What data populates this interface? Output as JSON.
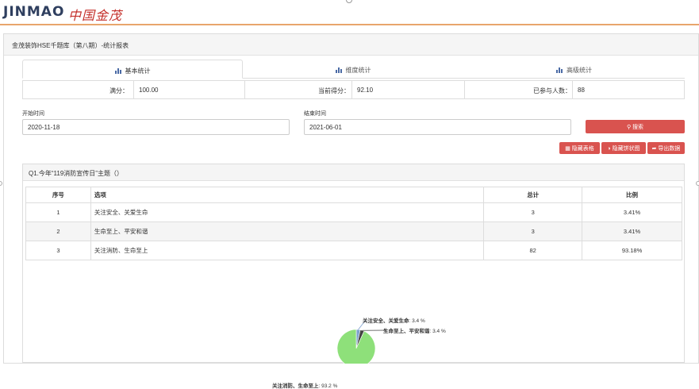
{
  "brand": {
    "logo_en": "JINMAO",
    "logo_cn": "中国金茂"
  },
  "panel": {
    "title": "金茂装饰HSE千题库（第八期）-统计报表"
  },
  "tabs": [
    {
      "label": "基本统计",
      "active": true
    },
    {
      "label": "维度统计",
      "active": false
    },
    {
      "label": "高级统计",
      "active": false
    }
  ],
  "stats": {
    "full_score_label": "满分：",
    "full_score": "100.00",
    "current_label": "当前得分：",
    "current": "92.10",
    "participants_label": "已参与人数：",
    "participants": "88"
  },
  "filters": {
    "start_label": "开始时间",
    "start_value": "2020-11-18",
    "end_label": "结束时间",
    "end_value": "2021-06-01",
    "search_label": "搜索"
  },
  "actions": {
    "hide_table": "隐藏表格",
    "hide_pie": "隐藏饼状图",
    "export": "导出数据"
  },
  "question": {
    "title": "Q1.今年“119消防宣传日”主题（）",
    "headers": [
      "序号",
      "选项",
      "总计",
      "比例"
    ],
    "rows": [
      {
        "no": "1",
        "option": "关注安全、关爱生命",
        "total": "3",
        "ratio": "3.41%"
      },
      {
        "no": "2",
        "option": "生命至上、平安和谐",
        "total": "3",
        "ratio": "3.41%"
      },
      {
        "no": "3",
        "option": "关注消防、生命至上",
        "total": "82",
        "ratio": "93.18%"
      }
    ]
  },
  "chart_data": {
    "type": "pie",
    "slices": [
      {
        "name": "关注安全、关爱生命",
        "value": 3.4,
        "label_value": "3.4 %",
        "color": "#7fa1cf"
      },
      {
        "name": "生命至上、平安和谐",
        "value": 3.4,
        "label_value": "3.4 %",
        "color": "#444444"
      },
      {
        "name": "关注消防、生命至上",
        "value": 93.2,
        "label_value": "93.2 %",
        "color": "#8ee07a"
      }
    ]
  },
  "colors": {
    "accent_red": "#d9534f",
    "brand_orange": "#e8a56c",
    "pie_green": "#8ee07a"
  }
}
